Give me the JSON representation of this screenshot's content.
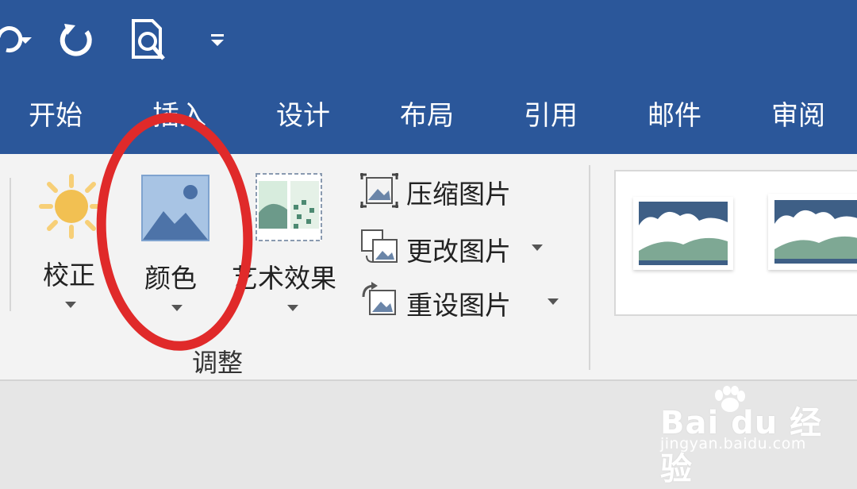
{
  "quick_access": {
    "items": [
      {
        "name": "undo-icon"
      },
      {
        "name": "redo-icon"
      },
      {
        "name": "print-preview-icon"
      },
      {
        "name": "customize-qat-icon"
      }
    ]
  },
  "tabs": [
    "开始",
    "插入",
    "设计",
    "布局",
    "引用",
    "邮件",
    "审阅"
  ],
  "ribbon": {
    "adjust_group": {
      "label": "调整",
      "correction_label": "校正",
      "color_label": "颜色",
      "artistic_label": "艺术效果",
      "compress_label": "压缩图片",
      "change_label": "更改图片",
      "reset_label": "重设图片"
    }
  },
  "watermark": {
    "brand": "Bai du 经验",
    "url": "jingyan.baidu.com"
  },
  "colors": {
    "ribbon_blue": "#2b579a",
    "annotation_red": "#e02a2a",
    "ribbon_bg": "#f3f3f3"
  }
}
